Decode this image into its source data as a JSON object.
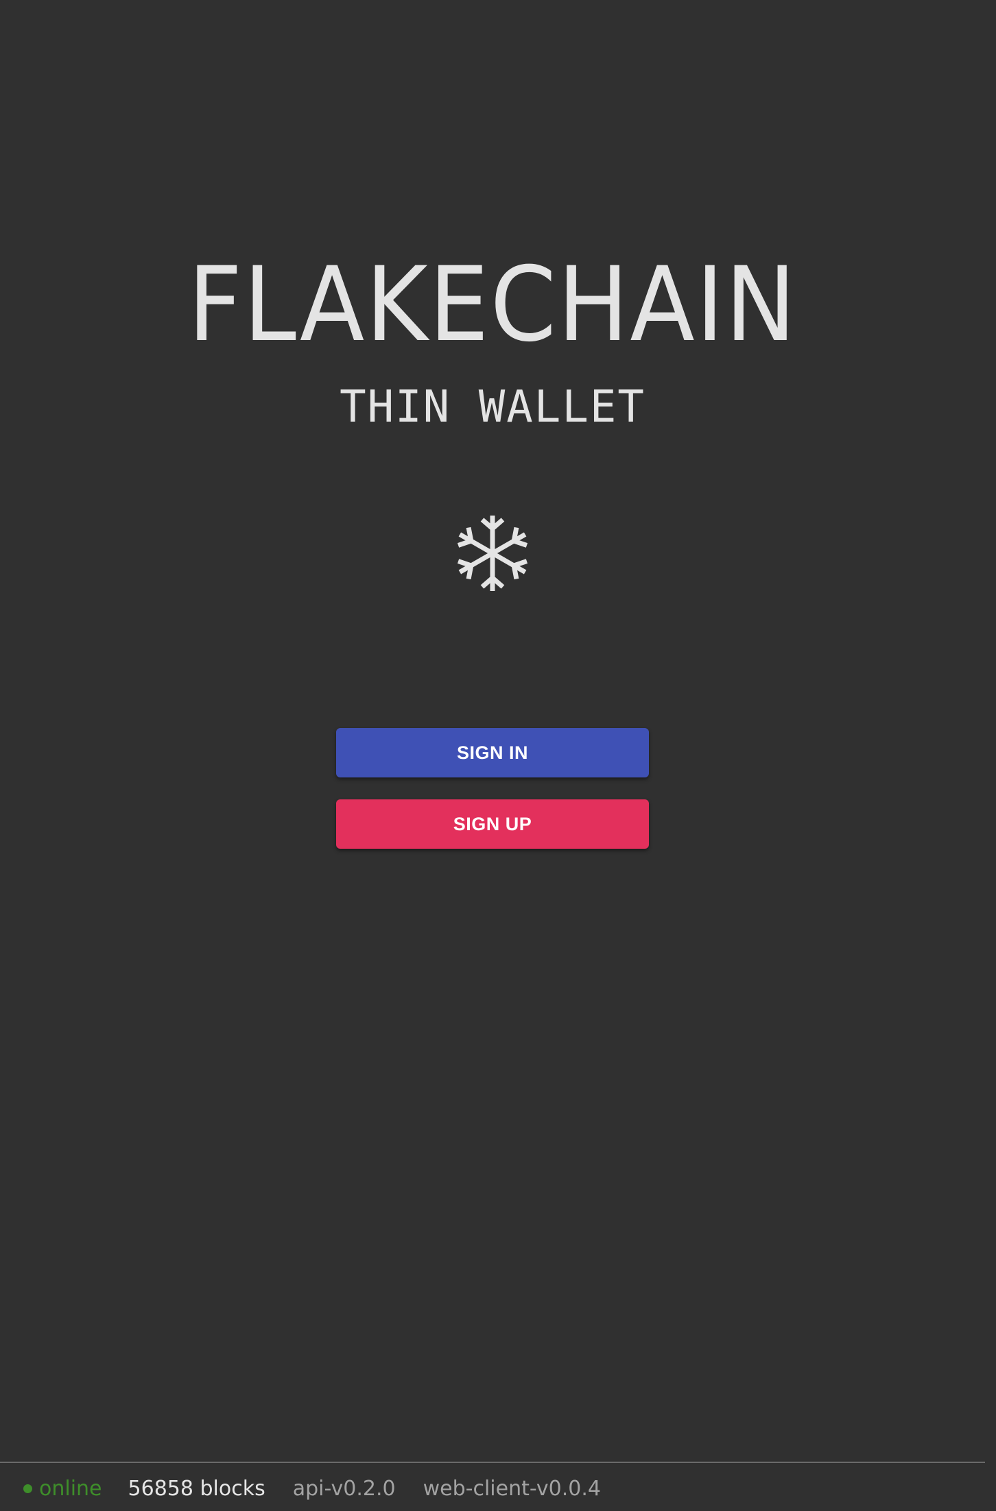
{
  "brand": {
    "title": "FLAKECHAIN",
    "subtitle": "THIN WALLET",
    "logo_icon": "snowflake-icon"
  },
  "actions": {
    "sign_in_label": "SIGN IN",
    "sign_up_label": "SIGN UP"
  },
  "footer": {
    "status_text": "online",
    "status_color": "#3e8e2a",
    "blocks_text": "56858 blocks",
    "api_version": "api-v0.2.0",
    "client_version": "web-client-v0.0.4"
  },
  "colors": {
    "background": "#303030",
    "primary": "#3f51b5",
    "accent": "#e3305c"
  }
}
